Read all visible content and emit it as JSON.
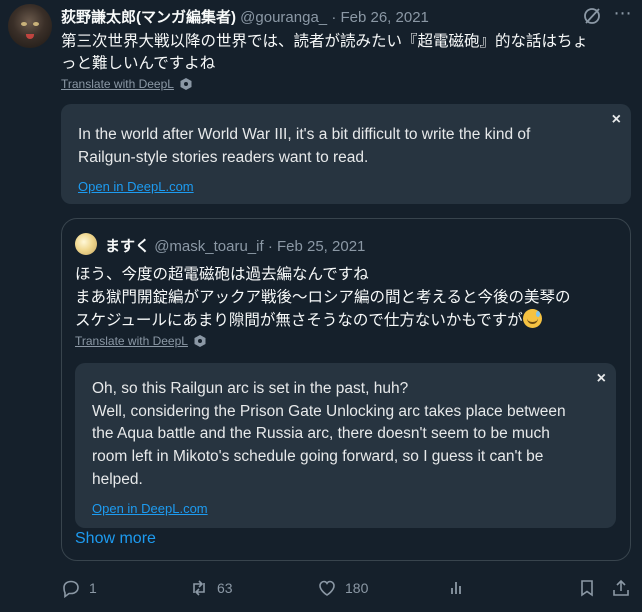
{
  "tweet": {
    "author_name": "荻野謙太郎(マンガ編集者)",
    "author_handle": "@gouranga_",
    "separator": "·",
    "date": "Feb 26, 2021",
    "text_line1": "第三次世界大戦以降の世界では、読者が読みたい『超電磁砲』的な話はちょ",
    "text_line2": "っと難しいんですよね",
    "translate_label": "Translate with DeepL"
  },
  "translation": {
    "line1": "In the world after World War III, it's a bit difficult to write the kind of",
    "line2": "Railgun-style stories readers want to read.",
    "open_link": "Open in DeepL.com",
    "close": "×"
  },
  "quote": {
    "author_name": "ますく",
    "author_handle": "@mask_toaru_if",
    "separator": "·",
    "date": "Feb 25, 2021",
    "line1": "ほう、今度の超電磁砲は過去編なんですね",
    "line2": "まあ獄門開錠編がアックア戦後〜ロシア編の間と考えると今後の美琴の",
    "line3": "スケジュールにあまり隙間が無さそうなので仕方ないかもですが",
    "emoji": "sweat-smile-emoji",
    "translate_label": "Translate with DeepL",
    "translation": {
      "line1": "Oh, so this Railgun arc is set in the past, huh?",
      "line2": "Well, considering the Prison Gate Unlocking arc takes place between",
      "line3": "the Aqua battle and the Russia arc, there doesn't seem to be much",
      "line4": "room left in Mikoto's schedule going forward, so I guess it can't be",
      "line5": "helped.",
      "open_link": "Open in DeepL.com",
      "close": "×"
    },
    "show_more": "Show more"
  },
  "actions": {
    "replies": "1",
    "retweets": "63",
    "likes": "180"
  },
  "colors": {
    "background": "#15202b",
    "card": "#273440",
    "link": "#1d9bf0",
    "muted": "#8b98a5"
  }
}
